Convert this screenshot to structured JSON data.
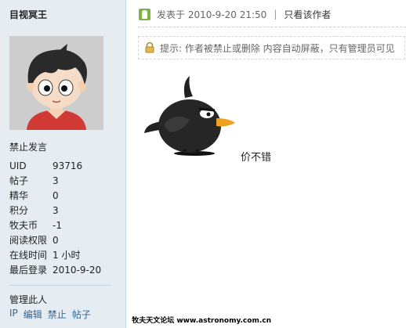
{
  "author": {
    "name": "目视冥王",
    "group": "禁止发言",
    "stats": [
      {
        "key": "UID",
        "value": "93716"
      },
      {
        "key": "帖子",
        "value": "3"
      },
      {
        "key": "精华",
        "value": "0"
      },
      {
        "key": "积分",
        "value": "3"
      },
      {
        "key": "牧夫币",
        "value": "-1"
      },
      {
        "key": "阅读权限",
        "value": "0"
      },
      {
        "key": "在线时间",
        "value": "1 小时"
      },
      {
        "key": "最后登录",
        "value": "2010-9-20"
      }
    ]
  },
  "manage": {
    "label": "管理此人",
    "links": [
      "IP",
      "编辑",
      "禁止",
      "帖子"
    ]
  },
  "post": {
    "posted_at": "发表于 2010-9-20 21:50",
    "separator": "|",
    "only_author": "只看该作者",
    "notice": "提示: 作者被禁止或删除 内容自动屏蔽，只有管理员可见",
    "body": "价不错"
  },
  "watermark": "牧夫天文论坛 www.astronomy.com.cn",
  "colors": {
    "sidebar_bg": "#e5edf2",
    "link": "#336699",
    "post_icon": "#7cb342"
  }
}
